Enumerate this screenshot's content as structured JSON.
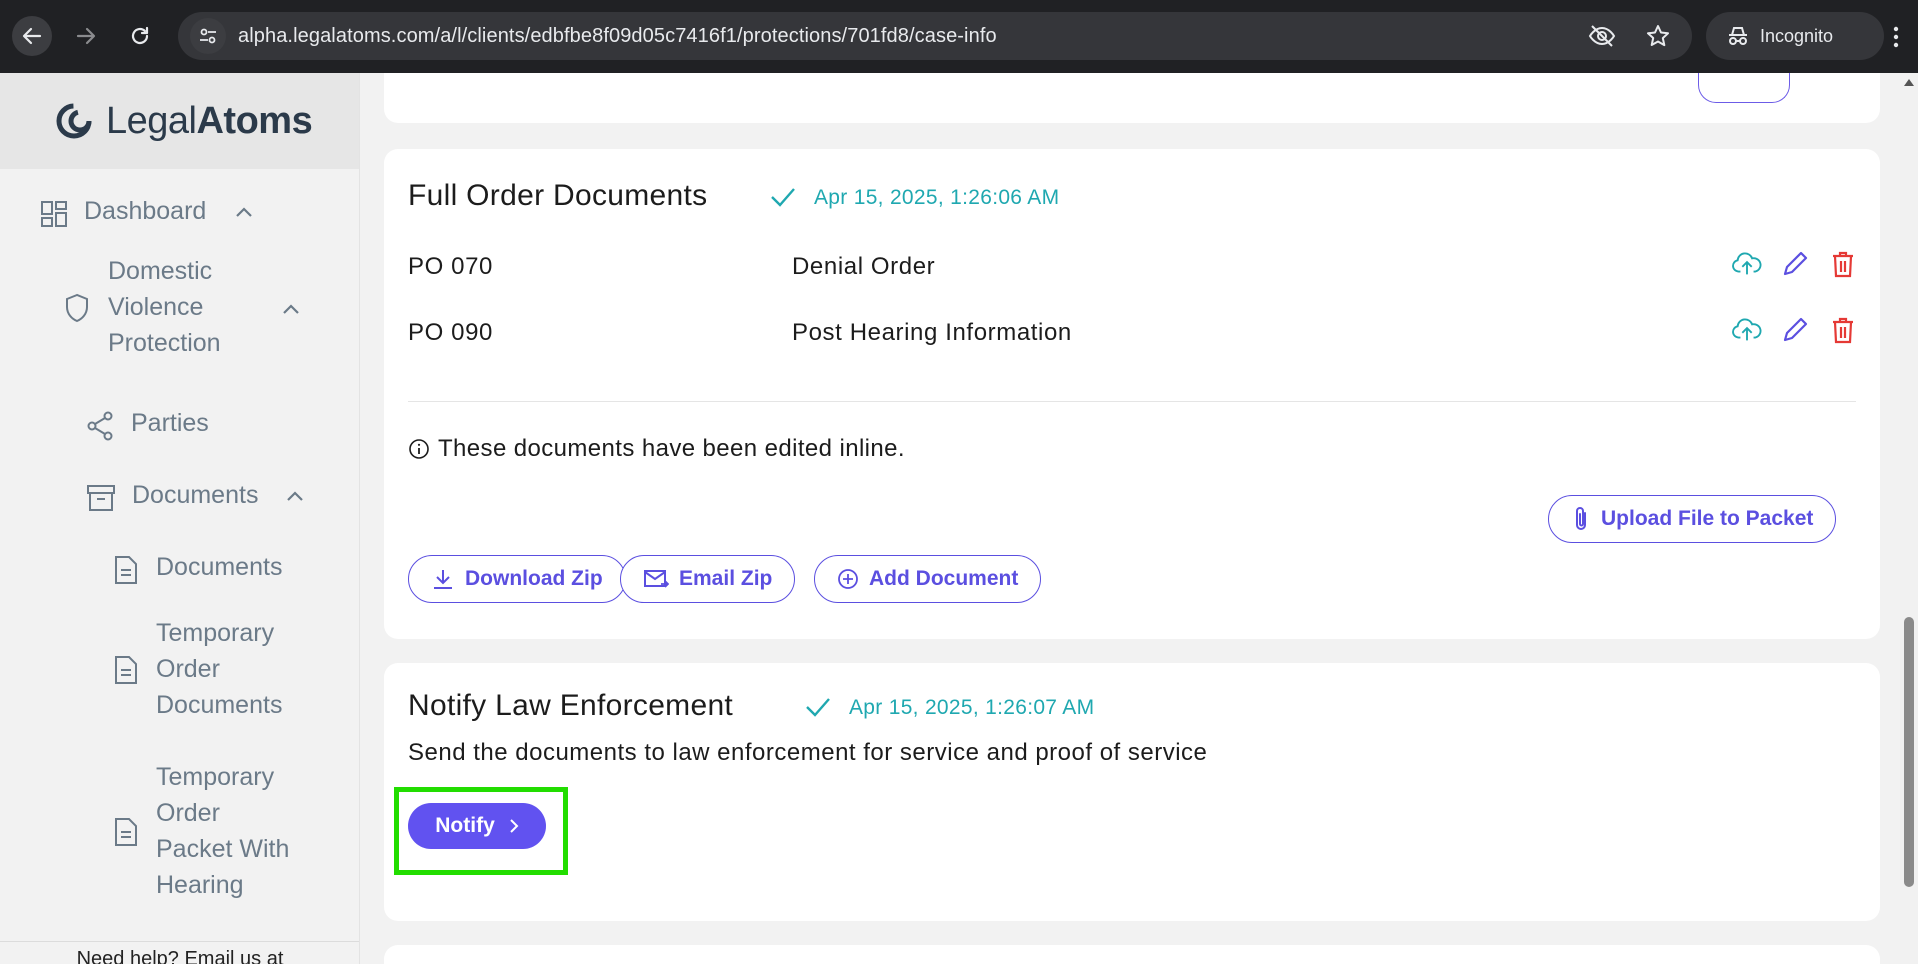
{
  "browser": {
    "url": "alpha.legalatoms.com/a/l/clients/edbfbe8f09d05c7416f1/protections/701fd8/case-info",
    "incognito_label": "Incognito"
  },
  "sidebar": {
    "logo": {
      "light": "Legal",
      "bold": "Atoms"
    },
    "items": [
      {
        "label": "Dashboard"
      },
      {
        "label": "Domestic Violence Protection",
        "lines": [
          "Domestic",
          "Violence",
          "Protection"
        ]
      },
      {
        "label": "Parties"
      },
      {
        "label": "Documents"
      },
      {
        "label": "Documents"
      },
      {
        "label": "Temporary Order Documents",
        "lines": [
          "Temporary",
          "Order",
          "Documents"
        ]
      },
      {
        "label": "Temporary Order Packet With Hearing",
        "lines": [
          "Temporary",
          "Order",
          "Packet With",
          "Hearing"
        ]
      }
    ],
    "help_text": "Need help? Email us at"
  },
  "full_order": {
    "title": "Full Order Documents",
    "timestamp": "Apr 15, 2025, 1:26:06 AM",
    "documents": [
      {
        "code": "PO 070",
        "name": "Denial Order"
      },
      {
        "code": "PO 090",
        "name": "Post Hearing Information"
      }
    ],
    "note": "These documents have been edited inline.",
    "upload_label": "Upload File to Packet",
    "download_zip_label": "Download Zip",
    "email_zip_label": "Email Zip",
    "add_document_label": "Add Document"
  },
  "notify": {
    "title": "Notify Law Enforcement",
    "timestamp": "Apr 15, 2025, 1:26:07 AM",
    "description": "Send the documents to law enforcement for service and proof of service",
    "button_label": "Notify"
  },
  "colors": {
    "accent": "#5b4fe0",
    "teal": "#1fa8b0",
    "delete": "#e53935",
    "highlight": "#22dd00"
  }
}
